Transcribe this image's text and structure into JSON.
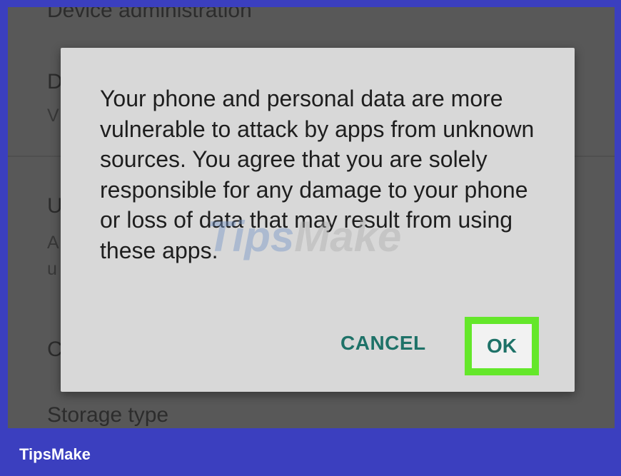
{
  "background": {
    "top_item": "Device administration",
    "item_d": "D",
    "item_d_sub": "V",
    "item_u": "U",
    "item_u_sub1": "A",
    "item_u_sub2": "u",
    "item_c": "C",
    "storage_type": "Storage type"
  },
  "dialog": {
    "message": "Your phone and personal data are more vulnerable to attack by apps from unknown sources. You agree that you are solely responsible for any damage to your phone or loss of data that may result from using these apps.",
    "cancel_label": "CANCEL",
    "ok_label": "OK"
  },
  "watermark": {
    "part1": "Tips",
    "part2": "Make"
  },
  "footer": {
    "brand": "TipsMake"
  },
  "colors": {
    "frame": "#3b3fbf",
    "highlight": "#64e72a",
    "button_text": "#1e7268"
  }
}
